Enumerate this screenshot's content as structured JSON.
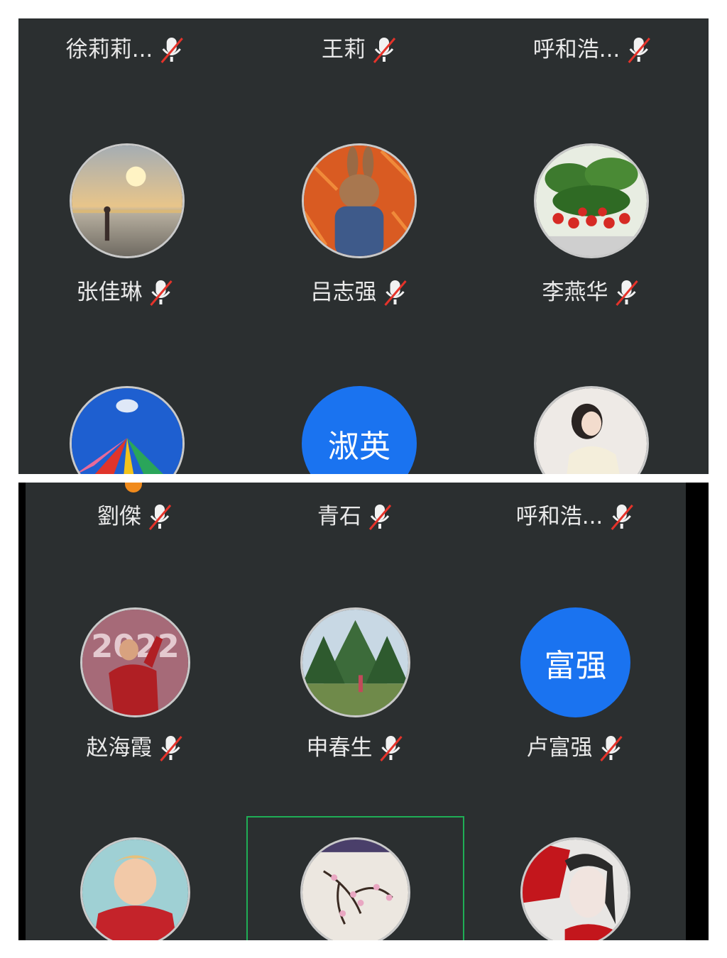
{
  "top_panel": {
    "row1": [
      {
        "name": "徐莉莉...",
        "muted": true
      },
      {
        "name": "王莉",
        "muted": true
      },
      {
        "name": "呼和浩...",
        "muted": true
      }
    ],
    "row2": [
      {
        "name": "张佳琳",
        "muted": true,
        "avatar": "sunset-beach-photo"
      },
      {
        "name": "吕志强",
        "muted": true,
        "avatar": "rabbit-carrots-photo"
      },
      {
        "name": "李燕华",
        "muted": true,
        "avatar": "strawberry-plant-photo"
      }
    ],
    "row3": [
      {
        "avatar": "colorful-flags-sky-photo"
      },
      {
        "avatar_text": "淑英"
      },
      {
        "avatar": "illustrated-woman-photo"
      }
    ]
  },
  "bottom_panel": {
    "row1": [
      {
        "name": "劉傑",
        "muted": true
      },
      {
        "name": "青石",
        "muted": true
      },
      {
        "name": "呼和浩...",
        "muted": true
      }
    ],
    "row2": [
      {
        "name": "赵海霞",
        "muted": true,
        "avatar": "person-2022-photo"
      },
      {
        "name": "申春生",
        "muted": true,
        "avatar": "forest-person-photo"
      },
      {
        "name": "卢富强",
        "muted": true,
        "avatar_text": "富强"
      }
    ],
    "row3": [
      {
        "avatar": "child-red-shirt-photo"
      },
      {
        "avatar": "plum-blossom-photo",
        "selected": true
      },
      {
        "avatar": "red-fan-girl-illustration"
      }
    ]
  },
  "colors": {
    "background": "#2b2f30",
    "text": "#e9e9e9",
    "initials_avatar": "#1a73f0",
    "mute_slash": "#e5332a",
    "selection_border": "#1fae55",
    "host_badge": "#f08a1c"
  }
}
